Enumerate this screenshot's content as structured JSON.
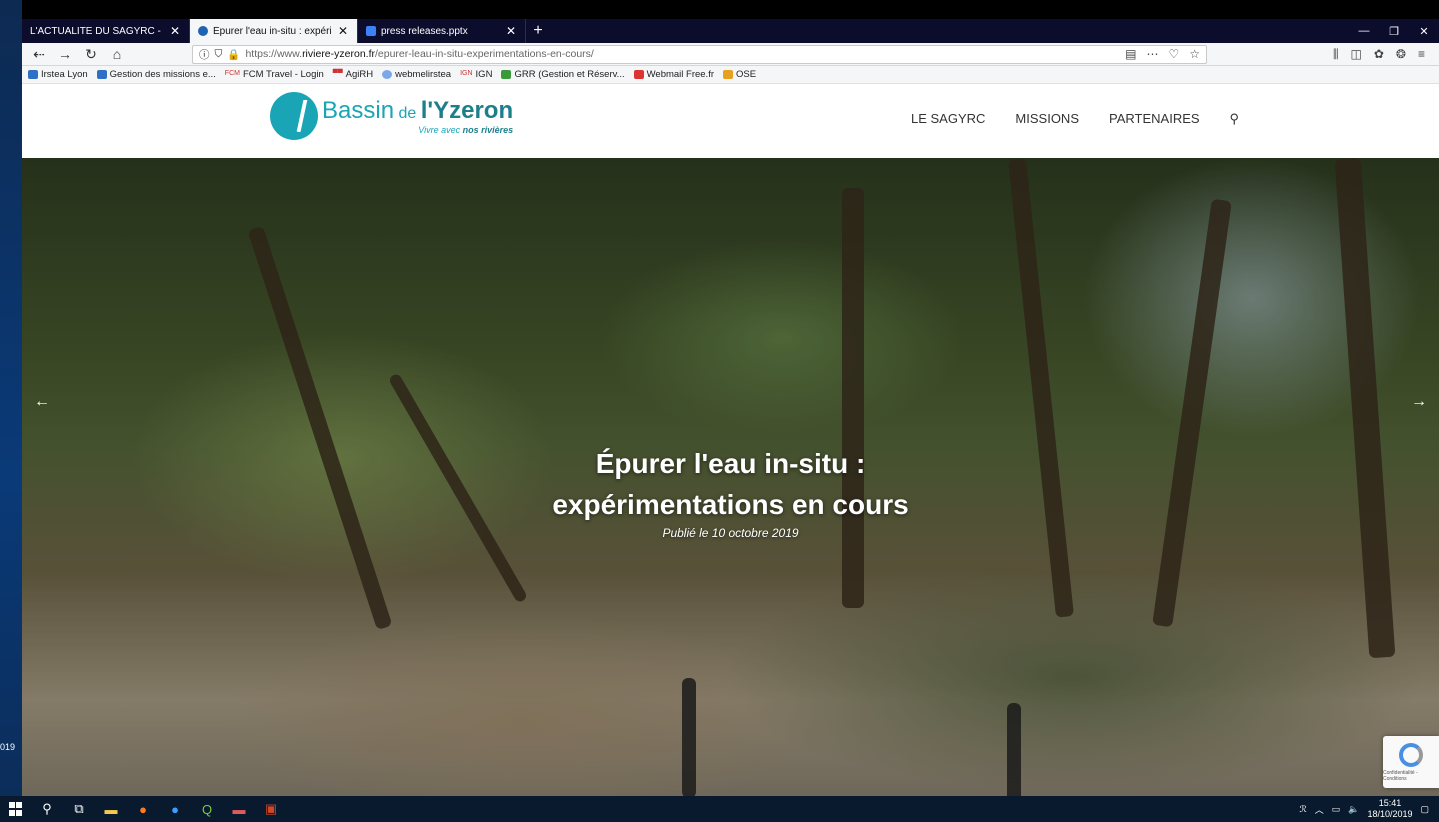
{
  "desktop": {
    "left_clip_text": "019"
  },
  "browser": {
    "tabs": [
      {
        "title": "L'ACTUALITE DU SAGYRC - Octob",
        "active": false
      },
      {
        "title": "Épurer l'eau in-situ : expérimen",
        "active": true
      },
      {
        "title": "press releases.pptx",
        "active": false
      }
    ],
    "new_tab": "+",
    "url_prefix": "https://www.",
    "url_domain": "riviere-yzeron.fr",
    "url_path": "/epurer-leau-in-situ-experimentations-en-cours/",
    "bookmarks": [
      {
        "label": "Irstea Lyon",
        "icon": "book-icon"
      },
      {
        "label": "Gestion des missions e...",
        "icon": "book-icon"
      },
      {
        "label": "FCM Travel - Login",
        "icon": "fcm-icon"
      },
      {
        "label": "AgiRH",
        "icon": "agirh-icon"
      },
      {
        "label": "webmelirstea",
        "icon": "globe-icon"
      },
      {
        "label": "IGN",
        "icon": "ign-icon"
      },
      {
        "label": "GRR (Gestion et Réserv...",
        "icon": "book-icon"
      },
      {
        "label": "Webmail Free.fr",
        "icon": "free-icon"
      },
      {
        "label": "OSE",
        "icon": "ose-icon"
      }
    ]
  },
  "site": {
    "logo_basin": "Bassin",
    "logo_de": " de ",
    "logo_yzeron": "l'Yzeron",
    "logo_tag_a": "Vivre avec ",
    "logo_tag_b": "nos rivières",
    "menu": [
      "LE SAGYRC",
      "MISSIONS",
      "PARTENAIRES"
    ],
    "hero_title_line1": "Épurer l'eau in-situ :",
    "hero_title_line2": "expérimentations en cours",
    "hero_date": "Publié le 10 octobre 2019",
    "arrow_prev": "←",
    "arrow_next": "→",
    "recaptcha_text": "Confidentialité - Conditions"
  },
  "taskbar": {
    "time": "15:41",
    "date": "18/10/2019"
  }
}
